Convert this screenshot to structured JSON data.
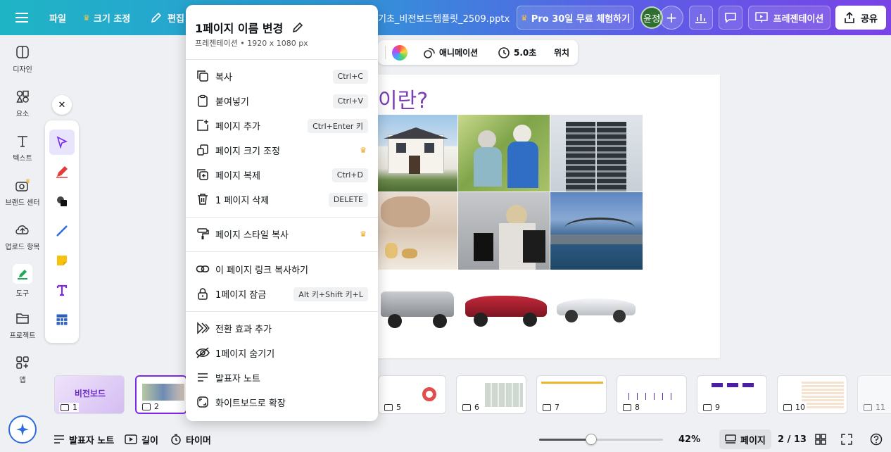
{
  "topbar": {
    "menu_file": "파일",
    "menu_resize": "크기 조정",
    "menu_edit": "편집",
    "doc_title": "기초_비전보드템플릿_2509.pptx",
    "pro_trial": "Pro 30일 무료 체험하기",
    "avatar": "윤정",
    "present": "프레젠테이션",
    "share": "공유"
  },
  "rail": [
    {
      "label": "디자인",
      "icon": "design-icon"
    },
    {
      "label": "요소",
      "icon": "elements-icon"
    },
    {
      "label": "텍스트",
      "icon": "text-icon"
    },
    {
      "label": "브랜드 센터",
      "icon": "brand-icon"
    },
    {
      "label": "업로드 항목",
      "icon": "upload-icon"
    },
    {
      "label": "도구",
      "icon": "draw-tool-icon"
    },
    {
      "label": "프로젝트",
      "icon": "folder-icon"
    },
    {
      "label": "앱",
      "icon": "apps-icon"
    }
  ],
  "context_toolbar": {
    "animate": "애니메이션",
    "duration": "5.0초",
    "position": "위치"
  },
  "slide": {
    "title_visible": "이란?"
  },
  "menu": {
    "title": "1페이지 이름 변경",
    "subtitle": "프레젠테이션 • 1920 x 1080 px",
    "items": [
      {
        "label": "복사",
        "shortcut": "Ctrl+C",
        "icon": "copy-icon"
      },
      {
        "label": "붙여넣기",
        "shortcut": "Ctrl+V",
        "icon": "paste-icon"
      },
      {
        "label": "페이지 추가",
        "shortcut": "Ctrl+Enter 키",
        "icon": "add-page-icon"
      },
      {
        "label": "페이지 크기 조정",
        "shortcut": "",
        "icon": "resize-icon"
      },
      {
        "label": "페이지 복제",
        "shortcut": "Ctrl+D",
        "icon": "duplicate-icon"
      },
      {
        "label": "1 페이지 삭제",
        "shortcut": "DELETE",
        "icon": "trash-icon"
      },
      {
        "label": "페이지 스타일 복사",
        "shortcut": "",
        "icon": "paint-roller-icon"
      },
      {
        "label": "이 페이지 링크 복사하기",
        "shortcut": "",
        "icon": "link-icon"
      },
      {
        "label": "1페이지 잠금",
        "shortcut": "Alt 키+Shift 키+L",
        "icon": "lock-icon"
      },
      {
        "label": "전환 효과 추가",
        "shortcut": "",
        "icon": "transition-icon"
      },
      {
        "label": "1페이지 숨기기",
        "shortcut": "",
        "icon": "eye-off-icon"
      },
      {
        "label": "발표자 노트",
        "shortcut": "",
        "icon": "notes-icon"
      },
      {
        "label": "화이트보드로 확장",
        "shortcut": "",
        "icon": "whiteboard-icon"
      }
    ]
  },
  "thumbs": [
    {
      "num": "1",
      "text": "비전보드"
    },
    {
      "num": "2"
    },
    {
      "num": "5"
    },
    {
      "num": "6"
    },
    {
      "num": "7"
    },
    {
      "num": "8"
    },
    {
      "num": "9"
    },
    {
      "num": "10"
    },
    {
      "num": "11"
    }
  ],
  "bottombar": {
    "notes": "발표자 노트",
    "duration": "길이",
    "timer": "타이머",
    "zoom": "42%",
    "zoom_level": 0.42,
    "pages": "페이지",
    "page_counter": "2 / 13"
  },
  "colors": {
    "accent": "#7d2ae8",
    "title_purple": "#7a3fb5"
  }
}
